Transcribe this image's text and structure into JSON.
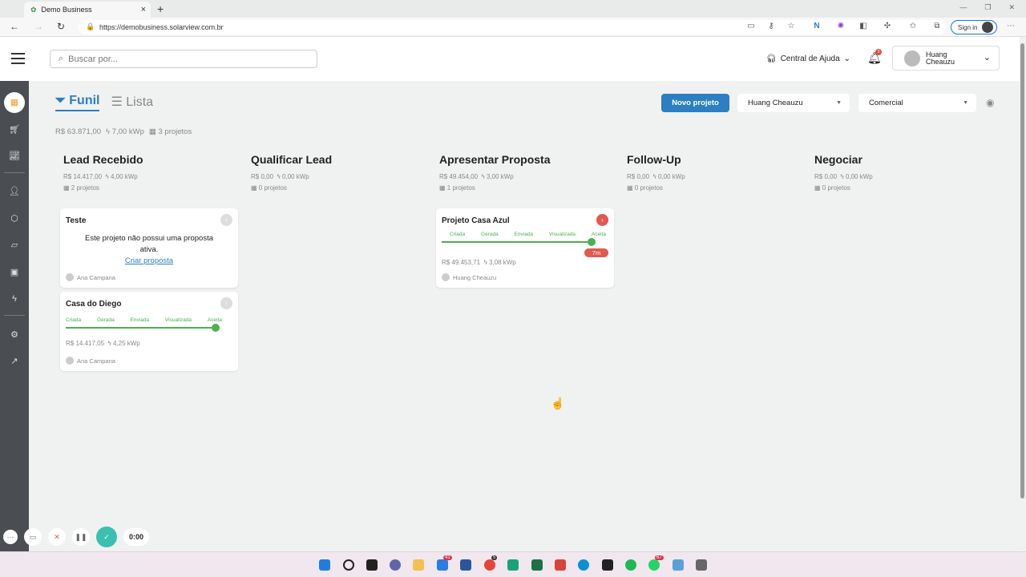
{
  "browser": {
    "tab_title": "Demo Business",
    "url": "https://demobusiness.solarview.com.br",
    "signin": "Sign in"
  },
  "header": {
    "search_placeholder": "Buscar por...",
    "help": "Central de Ajuda",
    "notif_count": "3",
    "user_name_1": "Huang",
    "user_name_2": "Cheauzu"
  },
  "views": {
    "funil": "Funil",
    "lista": "Lista"
  },
  "summary": {
    "value": "R$ 63.871,00",
    "power": "7,00 kWp",
    "projects": "3 projetos"
  },
  "toolbar": {
    "new_project": "Novo projeto",
    "user_filter": "Huang Cheauzu",
    "pipeline_filter": "Comercial"
  },
  "columns": [
    {
      "title": "Lead Recebido",
      "value": "R$ 14.417,00",
      "power": "4,00 kWp",
      "count": "2 projetos"
    },
    {
      "title": "Qualificar Lead",
      "value": "R$ 0,00",
      "power": "0,00 kWp",
      "count": "0 projetos"
    },
    {
      "title": "Apresentar Proposta",
      "value": "R$ 49.454,00",
      "power": "3,00 kWp",
      "count": "1 projetos"
    },
    {
      "title": "Follow-Up",
      "value": "R$ 0,00",
      "power": "0,00 kWp",
      "count": "0 projetos"
    },
    {
      "title": "Negociar",
      "value": "R$ 0,00",
      "power": "0,00 kWp",
      "count": "0 projetos"
    }
  ],
  "steps": [
    "Criada",
    "Gerada",
    "Enviada",
    "Visualizada",
    "Aceita"
  ],
  "cards": {
    "teste": {
      "title": "Teste",
      "message": "Este projeto não possui uma proposta ativa.",
      "link": "Criar proposta",
      "owner": "Ana Campana"
    },
    "diego": {
      "title": "Casa do Diego",
      "value": "R$ 14.417,05",
      "power": "4,25 kWp",
      "owner": "Ana Campana"
    },
    "azul": {
      "title": "Projeto Casa Azul",
      "badge": "7m",
      "value": "R$ 49.453,71",
      "power": "3,08 kWp",
      "owner": "Huang Cheauzu"
    }
  },
  "recorder": {
    "time": "0:00"
  },
  "taskbar": {
    "mail_badge": "41",
    "chrome_badge": "5",
    "whatsapp_badge": "67"
  }
}
